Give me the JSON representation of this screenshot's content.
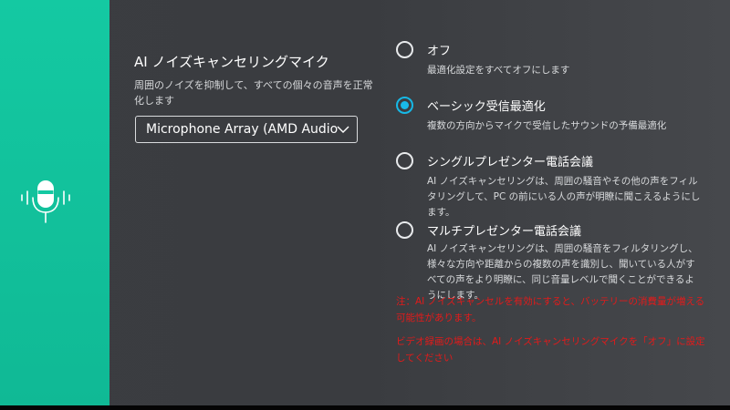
{
  "sidebar": {
    "icon": "microphone-icon",
    "accent_color": "#14c9a2"
  },
  "settings": {
    "title": "AI ノイズキャンセリングマイク",
    "description": "周囲のノイズを抑制して、すべての個々の音声を正常化します",
    "device_select": {
      "value": "Microphone Array (AMD Audio",
      "icon": "chevron-down-icon"
    }
  },
  "options": [
    {
      "label": "オフ",
      "description": "最適化設定をすべてオフにします",
      "selected": false
    },
    {
      "label": "ベーシック受信最適化",
      "description": "複数の方向からマイクで受信したサウンドの予備最適化",
      "selected": true
    },
    {
      "label": "シングルプレゼンター電話会議",
      "description": "AI ノイズキャンセリングは、周囲の騒音やその他の声をフィルタリングして、PC の前にいる人の声が明瞭に聞こえるようにします。",
      "selected": false
    },
    {
      "label": "マルチプレゼンター電話会議",
      "description": "AI ノイズキャンセリングは、周囲の騒音をフィルタリングし、様々な方向や距離からの複数の声を識別し、聞いている人がすべての声をより明瞭に、同じ音量レベルで聞くことができるようにします。",
      "selected": false
    }
  ],
  "notes": [
    "注：AI ノイズキャンセルを有効にすると、バッテリーの消費量が増える可能性があります。",
    "ビデオ録画の場合は、AI ノイズキャンセリングマイクを「オフ」に設定してください"
  ],
  "colors": {
    "accent": "#19b9e8",
    "warning": "#e31a1a"
  }
}
